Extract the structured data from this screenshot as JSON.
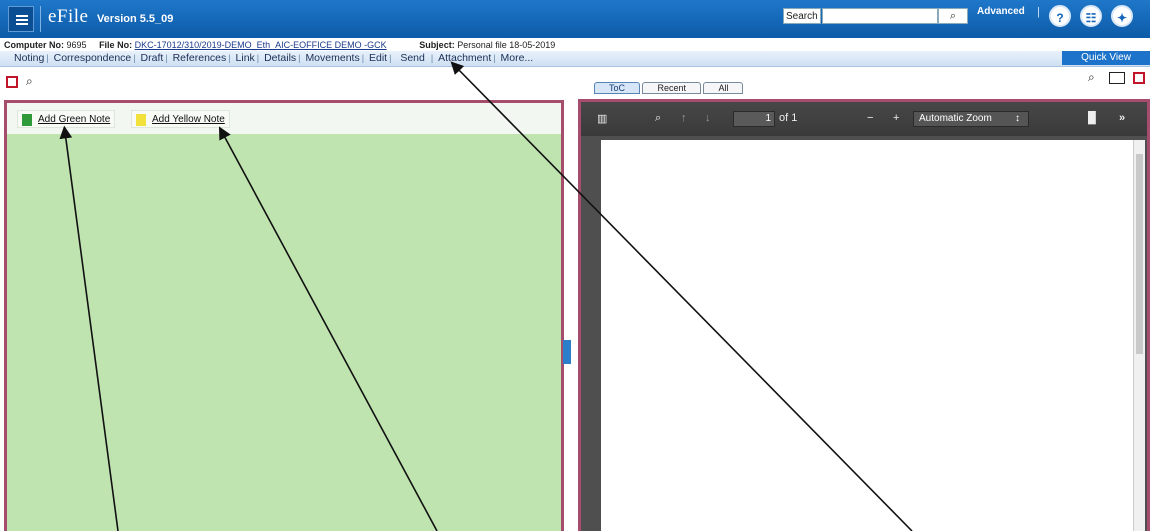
{
  "header": {
    "app_name": "eFile",
    "version": "Version 5.5_09",
    "search_label": "Search",
    "search_placeholder": "",
    "advanced_label": "Advanced",
    "separator": "|"
  },
  "info": {
    "computer_no_label": "Computer No:",
    "computer_no": "9695",
    "file_no_label": "File No:",
    "file_no": "DKC-17012/310/2019-DEMO_Eth_AIC-EOFFICE DEMO -GCK",
    "subject_label": "Subject:",
    "subject": "Personal file 18-05-2019"
  },
  "menu": {
    "items": [
      "Noting",
      "Correspondence",
      "Draft",
      "References",
      "Link",
      "Details",
      "Movements",
      "Edit",
      "Send",
      "Attachment",
      "More..."
    ],
    "quick_view": "Quick View"
  },
  "tabs": [
    "ToC",
    "Recent",
    "All"
  ],
  "notes": {
    "add_green": "Add Green Note",
    "add_yellow": "Add Yellow Note"
  },
  "pdf": {
    "page_value": "1",
    "page_of": "of 1",
    "zoom": "Automatic Zoom"
  },
  "icons": {
    "menu": "hamburger-icon",
    "help": "help-icon",
    "document": "document-icon",
    "gift": "gift-icon"
  },
  "colors": {
    "header_blue": "#0d5ba8",
    "panel_border": "#a64d6e",
    "note_area_green": "#bfe4b0",
    "pdf_toolbar": "#3a3a3a"
  }
}
